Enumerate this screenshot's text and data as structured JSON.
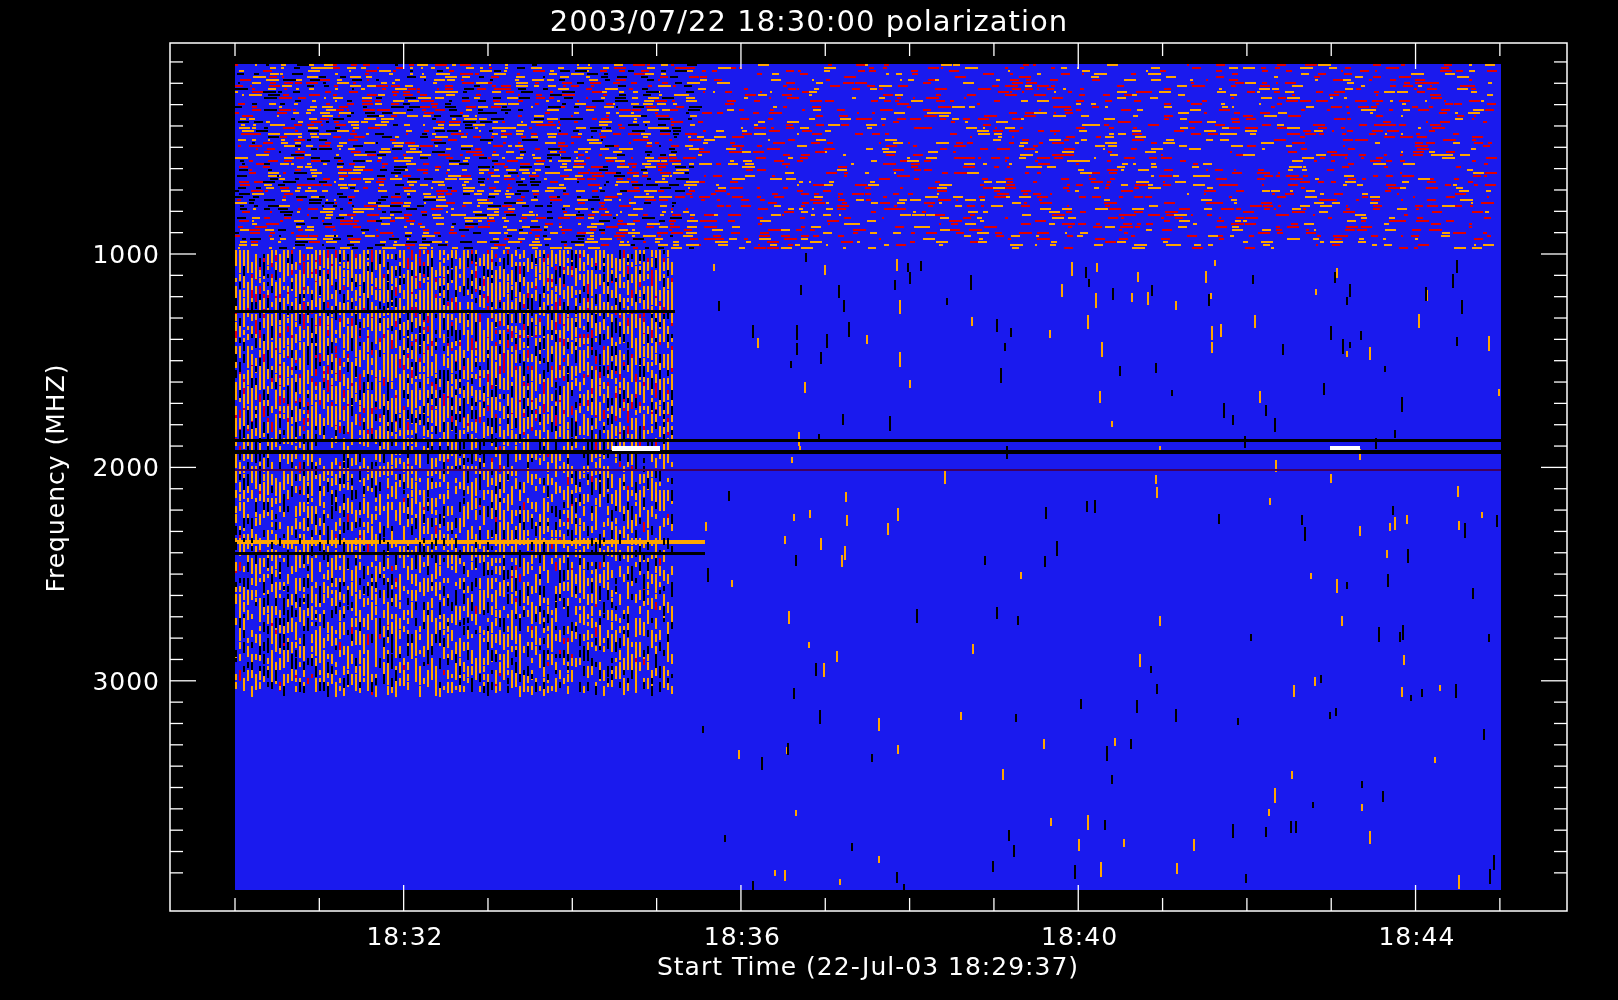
{
  "title": "2003/07/22 18:30:00 polarization",
  "y_axis": {
    "label": "Frequency (MHZ)",
    "ticks": [
      "1000",
      "2000",
      "3000"
    ]
  },
  "x_axis": {
    "label": "Start Time (22-Jul-03 18:29:37)",
    "ticks": [
      "18:32",
      "18:36",
      "18:40",
      "18:44"
    ]
  }
}
